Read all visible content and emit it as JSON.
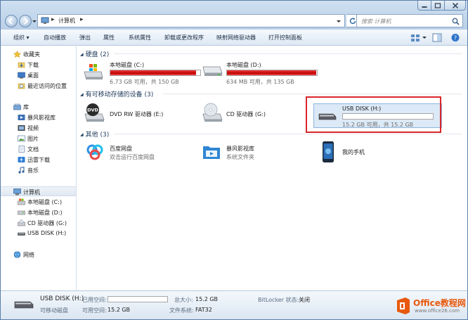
{
  "address": {
    "crumbs": [
      "计算机"
    ]
  },
  "search": {
    "placeholder": "搜索 计算机"
  },
  "toolbar": {
    "organize": "组织 ▾",
    "autoplay": "自动播放",
    "eject": "弹出",
    "properties": "属性",
    "system_properties": "系统属性",
    "uninstall": "卸载或更改程序",
    "map_drive": "映射网络驱动器",
    "control_panel": "打开控制面板"
  },
  "nav": {
    "favorites": "收藏夹",
    "downloads": "下载",
    "desktop": "桌面",
    "recent": "最近访问的位置",
    "libraries": "库",
    "storm_video": "暴风影视库",
    "videos": "视频",
    "pictures": "图片",
    "documents": "文档",
    "thunder": "迅雷下载",
    "music": "音乐",
    "computer": "计算机",
    "drive_c": "本地磁盘 (C:)",
    "drive_d": "本地磁盘 (D:)",
    "drive_g": "CD 驱动器 (G:)",
    "drive_h": "USB DISK (H:)",
    "network": "网络"
  },
  "groups": {
    "hdd": "硬盘 (2)",
    "removable": "有可移动存储的设备 (3)",
    "other": "其他 (3)"
  },
  "drives": {
    "c": {
      "name": "本地磁盘 (C:)",
      "space": "6.73 GB 可用，共 150 GB",
      "used_fraction": 0.955
    },
    "d": {
      "name": "本地磁盘 (D:)",
      "space": "634 MB 可用，共 135 GB",
      "used_fraction": 0.995
    },
    "e": {
      "name": "DVD RW 驱动器 (E:)"
    },
    "g": {
      "name": "CD 驱动器 (G:)"
    },
    "h": {
      "name": "USB DISK (H:)",
      "space": "15.2 GB 可用，共 15.2 GB",
      "used_fraction": 0.0
    }
  },
  "others": {
    "baidu": {
      "name": "百度网盘",
      "desc": "双击运行百度网盘"
    },
    "storm": {
      "name": "暴风影视库",
      "desc": "系统文件夹"
    },
    "phone": {
      "name": "我的手机"
    }
  },
  "details": {
    "name": "USB DISK (H:)",
    "type": "可移动磁盘",
    "used_label": "已用空间:",
    "free_label": "可用空间:",
    "free_value": "15.2 GB",
    "total_label": "总大小:",
    "total_value": "15.2 GB",
    "fs_label": "文件系统:",
    "fs_value": "FAT32",
    "bitlocker_label": "BitLocker 状态:",
    "bitlocker_value": "关闭"
  },
  "watermark": {
    "title": "Office教程网",
    "url": "www.office26.com"
  },
  "colors": {
    "accent": "#3a6ea5",
    "bar_red": "#d0021b",
    "highlight": "#d9262b",
    "brand_orange": "#e8590c"
  }
}
